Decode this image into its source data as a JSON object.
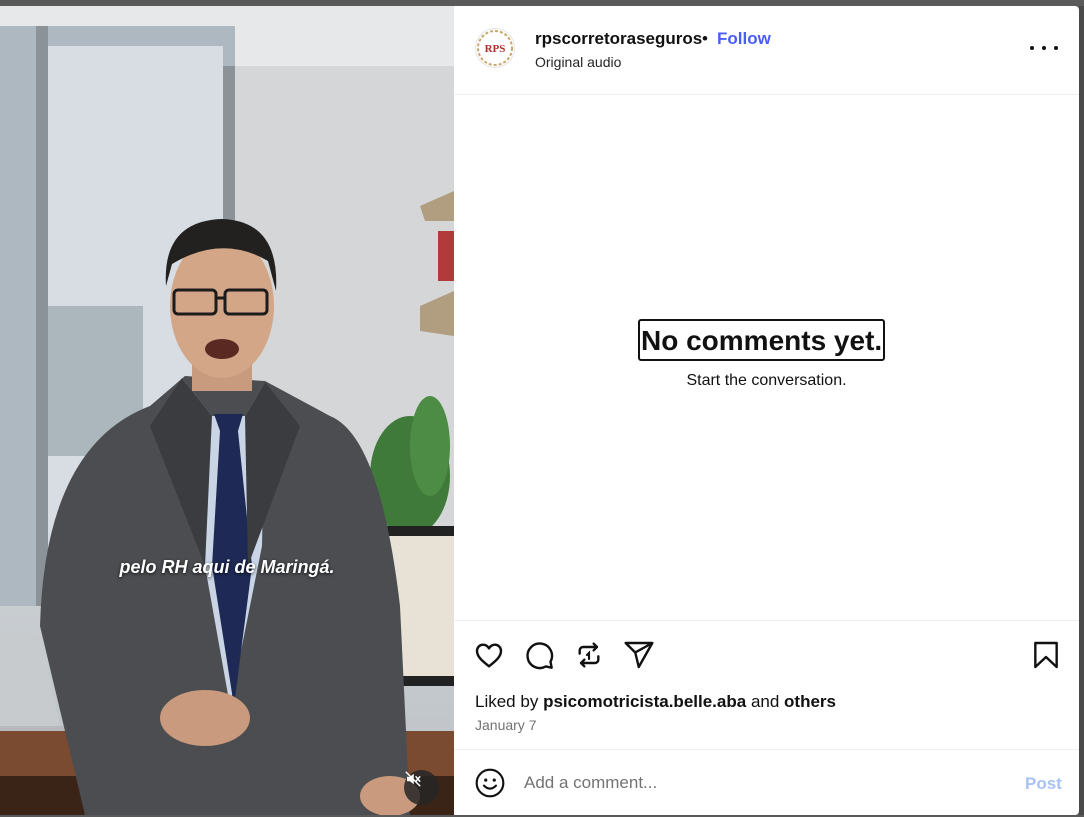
{
  "video": {
    "caption": "pelo RH aqui de Maringá.",
    "mute_icon": "speaker-muted-icon"
  },
  "post": {
    "username": "rpscorretoraseguros",
    "separator": "•",
    "follow_label": "Follow",
    "audio_label": "Original audio",
    "avatar_text": "RPS",
    "more_icon": "more-options-icon"
  },
  "comments": {
    "empty_title": "No comments yet.",
    "empty_subtitle": "Start the conversation."
  },
  "actions": {
    "icons": [
      "heart-icon",
      "comment-icon",
      "repost-icon",
      "share-icon",
      "bookmark-icon"
    ],
    "liked_prefix": "Liked by",
    "liked_user": "psicomotricista.belle.aba",
    "liked_and": "and",
    "liked_others": "others",
    "date": "January 7"
  },
  "comment_bar": {
    "placeholder": "Add a comment...",
    "post_label": "Post",
    "emoji_icon": "emoji-icon"
  },
  "colors": {
    "follow": "#4a5df9",
    "post_disabled": "#a8c2f7",
    "secondary_text": "#737373"
  }
}
